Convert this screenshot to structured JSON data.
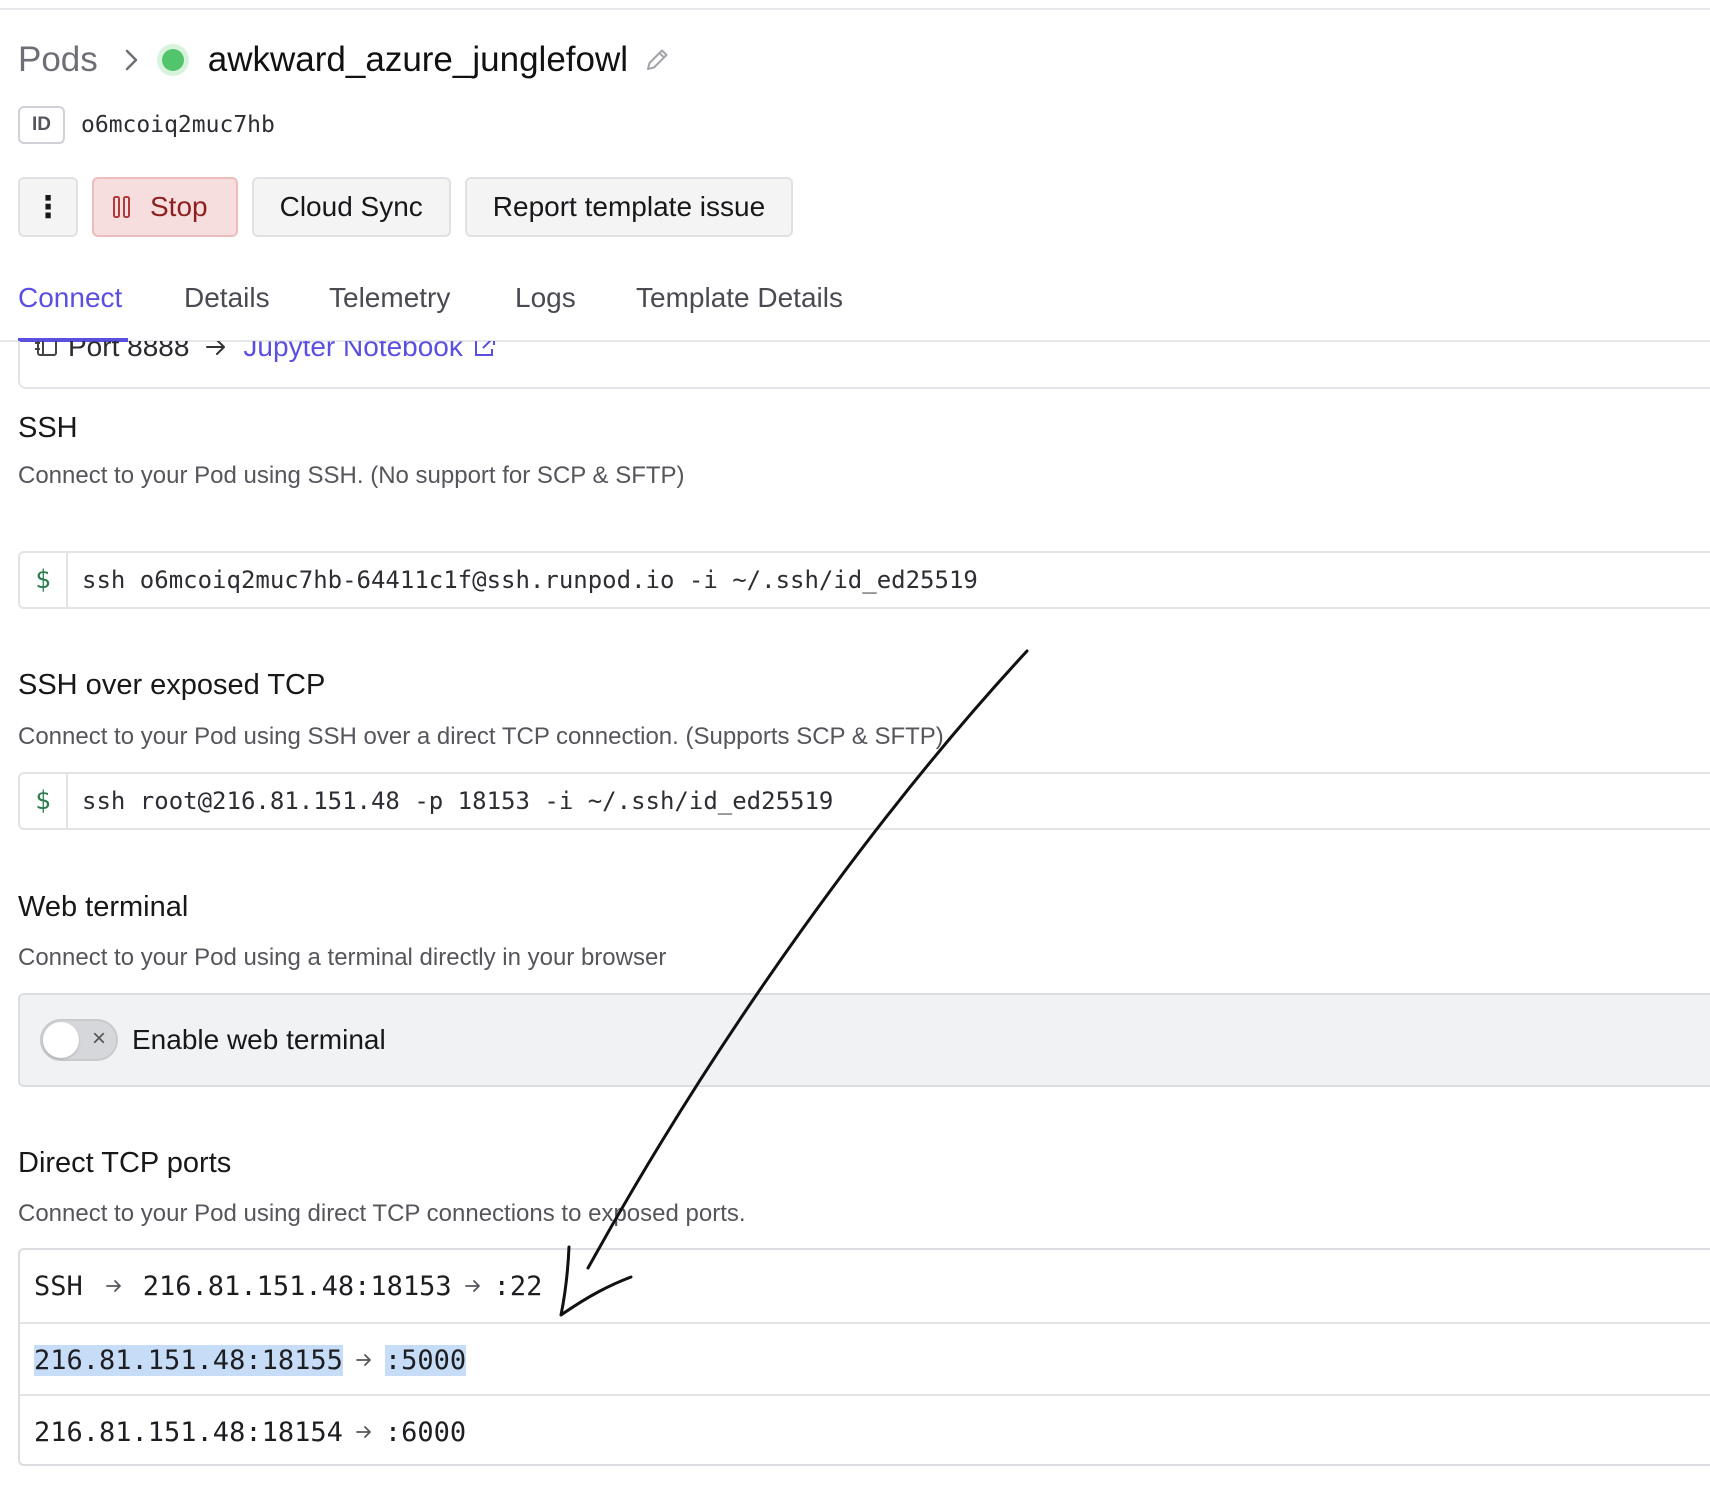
{
  "header": {
    "breadcrumb_root": "Pods",
    "pod_name": "awkward_azure_junglefowl",
    "id_label": "ID",
    "id_value": "o6mcoiq2muc7hb",
    "status_color": "#52c46b"
  },
  "actions": {
    "more_icon": "⋮",
    "stop_label": "Stop",
    "cloud_sync_label": "Cloud Sync",
    "report_label": "Report template issue"
  },
  "tabs": [
    {
      "label": "Connect",
      "active": true
    },
    {
      "label": "Details"
    },
    {
      "label": "Telemetry"
    },
    {
      "label": "Logs"
    },
    {
      "label": "Template Details"
    }
  ],
  "http_port": {
    "port_label": "Port 8888",
    "service_label": "Jupyter Notebook"
  },
  "ssh": {
    "title": "SSH",
    "description": "Connect to your Pod using SSH. (No support for SCP & SFTP)",
    "prompt": "$",
    "command": "ssh o6mcoiq2muc7hb-64411c1f@ssh.runpod.io -i ~/.ssh/id_ed25519"
  },
  "ssh_tcp": {
    "title": "SSH over exposed TCP",
    "description": "Connect to your Pod using SSH over a direct TCP connection. (Supports SCP & SFTP)",
    "prompt": "$",
    "command": "ssh root@216.81.151.48 -p 18153 -i ~/.ssh/id_ed25519"
  },
  "web_terminal": {
    "title": "Web terminal",
    "description": "Connect to your Pod using a terminal directly in your browser",
    "toggle_label": "Enable web terminal",
    "toggle_x": "×"
  },
  "tcp_ports": {
    "title": "Direct TCP ports",
    "description": "Connect to your Pod using direct TCP connections to exposed ports.",
    "rows": [
      {
        "name": "SSH",
        "ip": "216.81.151.48:",
        "port": "18153",
        "internal": ":22"
      },
      {
        "ip": "216.81.151.48:",
        "port": "18155",
        "internal": ":5000"
      },
      {
        "ip": "216.81.151.48:",
        "port": "18154",
        "internal": ":6000"
      }
    ]
  },
  "colors": {
    "accent": "#5b4fe0",
    "stop_bg": "#f7dede",
    "stop_text": "#8e1f1f",
    "selection": "#c6dcf7"
  }
}
